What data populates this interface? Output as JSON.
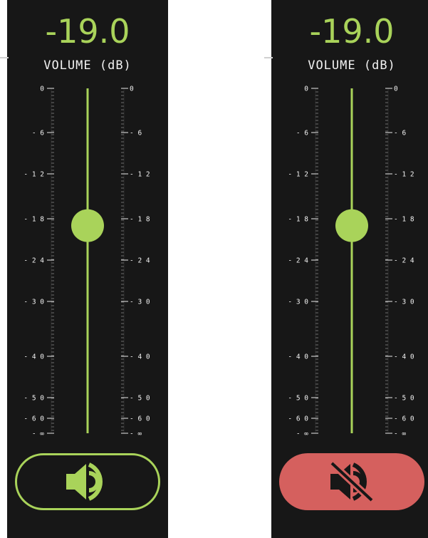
{
  "colors": {
    "accent": "#a9d35a",
    "muted_button": "#d5605e",
    "background": "#171717",
    "text": "#f2f2f2",
    "tick": "#c8c8c8"
  },
  "scale": [
    "0",
    "- 6",
    "- 1 2",
    "- 1 8",
    "- 2 4",
    "- 3 0",
    "- 4 0",
    "- 5 0",
    "- 6 0",
    "- ∞"
  ],
  "scale_right": [
    "0",
    "- 6",
    "- 1 2",
    "- 1 8",
    "- 2 4",
    "- 3 0",
    "- 4 0",
    "- 5 0",
    "- 6 0",
    "- ∞"
  ],
  "strips": [
    {
      "readout": "-19.0",
      "unit_label": "VOLUME (dB)",
      "volume_db": -19.0,
      "muted": false,
      "button_icon": "speaker-icon"
    },
    {
      "readout": "-19.0",
      "unit_label": "VOLUME (dB)",
      "volume_db": -19.0,
      "muted": true,
      "button_icon": "speaker-muted-icon"
    }
  ]
}
